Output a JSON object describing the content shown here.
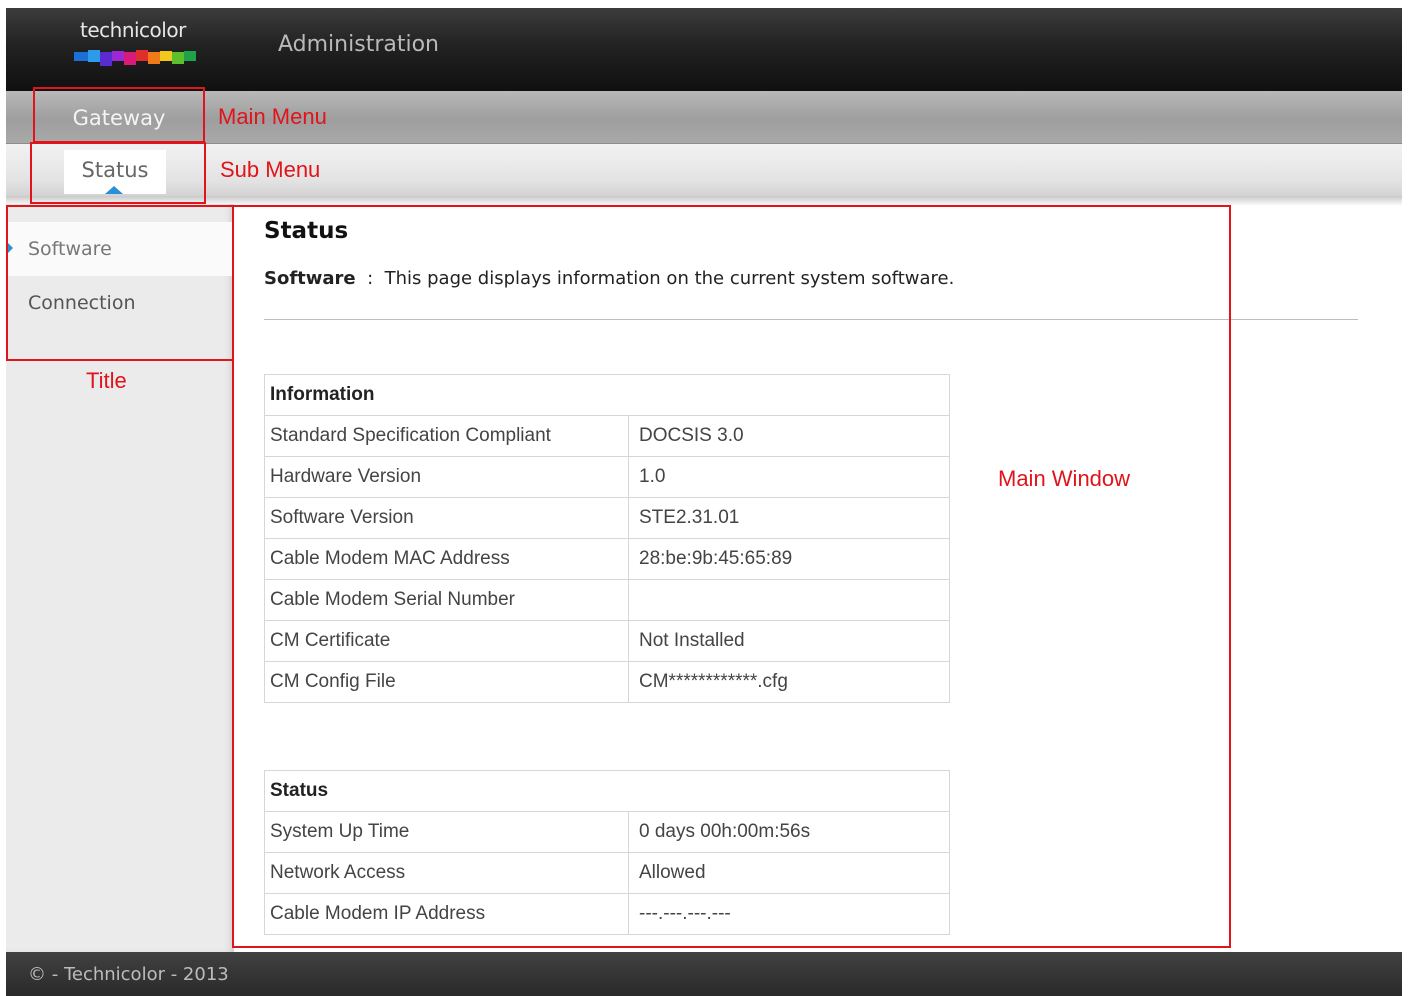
{
  "header": {
    "logo_text": "technicolor",
    "title": "Administration"
  },
  "main_menu": {
    "gateway_label": "Gateway"
  },
  "sub_menu": {
    "status_label": "Status"
  },
  "sidebar": {
    "items": [
      {
        "label": "Software",
        "active": true
      },
      {
        "label": "Connection",
        "active": false
      }
    ]
  },
  "content": {
    "title": "Status",
    "desc_label": "Software",
    "desc_sep": ":",
    "desc_text": "This page displays information on the current system software.",
    "info_table": {
      "header": "Information",
      "rows": [
        {
          "label": "Standard Specification Compliant",
          "value": "DOCSIS 3.0"
        },
        {
          "label": "Hardware Version",
          "value": "1.0"
        },
        {
          "label": "Software Version",
          "value": "STE2.31.01"
        },
        {
          "label": "Cable Modem MAC Address",
          "value": "28:be:9b:45:65:89"
        },
        {
          "label": "Cable Modem Serial Number",
          "value": ""
        },
        {
          "label": "CM Certificate",
          "value": "Not Installed"
        },
        {
          "label": "CM Config File",
          "value": "CM************.cfg"
        }
      ]
    },
    "status_table": {
      "header": "Status",
      "rows": [
        {
          "label": "System Up Time",
          "value": "0 days 00h:00m:56s"
        },
        {
          "label": "Network Access",
          "value": "Allowed"
        },
        {
          "label": "Cable Modem IP Address",
          "value": "---.---.---.---"
        }
      ]
    }
  },
  "footer": {
    "text": "© - Technicolor - 2013"
  },
  "annotations": {
    "main_menu": "Main Menu",
    "sub_menu": "Sub Menu",
    "title": "Title",
    "main_window": "Main Window"
  },
  "colors": {
    "accent": "#2a8fd6",
    "annotation": "#e0141a"
  }
}
